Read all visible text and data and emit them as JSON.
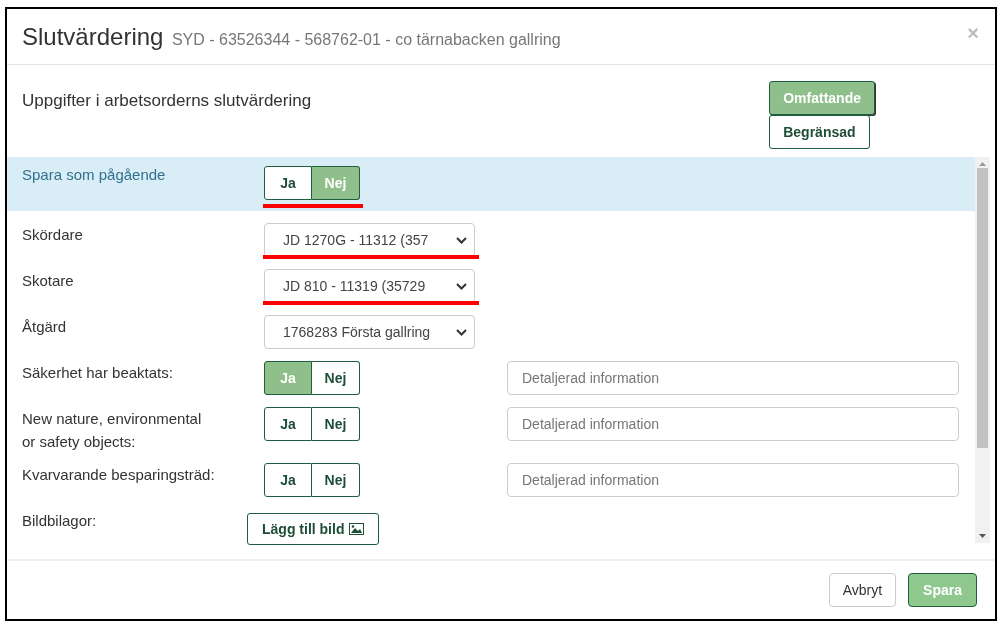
{
  "dialog": {
    "title": "Slutvärdering",
    "subtitle": "SYD - 63526344 - 568762-01 - co tärnabacken gallring",
    "close": "×"
  },
  "section": {
    "heading": "Uppgifter i arbetsorderns slutvärdering",
    "modes": [
      {
        "label": "Omfattande",
        "selected": true
      },
      {
        "label": "Begränsad",
        "selected": false
      }
    ]
  },
  "rows": [
    {
      "kind": "toggle",
      "label": "Spara som pågående",
      "highlighted": true,
      "annotated": true,
      "options": [
        {
          "label": "Ja",
          "selected": false
        },
        {
          "label": "Nej",
          "selected": true
        }
      ]
    },
    {
      "kind": "select",
      "label": "Skördare",
      "annotated": true,
      "value": "JD 1270G - 11312 (357"
    },
    {
      "kind": "select",
      "label": "Skotare",
      "annotated": true,
      "value": "JD 810 - 11319 (35729"
    },
    {
      "kind": "select",
      "label": "Åtgärd",
      "value": "1768283 Första gallring"
    },
    {
      "kind": "toggle",
      "label": "Säkerhet har beaktats:",
      "options": [
        {
          "label": "Ja",
          "selected": true
        },
        {
          "label": "Nej",
          "selected": false
        }
      ],
      "placeholder": "Detaljerad information"
    },
    {
      "kind": "toggle",
      "label": "New nature, environmental or safety objects:",
      "options": [
        {
          "label": "Ja",
          "selected": false
        },
        {
          "label": "Nej",
          "selected": false
        }
      ],
      "placeholder": "Detaljerad information"
    },
    {
      "kind": "toggle",
      "label": "Kvarvarande besparingsträd:",
      "options": [
        {
          "label": "Ja",
          "selected": false
        },
        {
          "label": "Nej",
          "selected": false
        }
      ],
      "placeholder": "Detaljerad information"
    },
    {
      "kind": "button",
      "label": "Bildbilagor:",
      "button": "Lägg till bild"
    }
  ],
  "footer": {
    "buttons": [
      {
        "label": "Avbryt",
        "kind": "secondary"
      },
      {
        "label": "Spara",
        "kind": "primary"
      }
    ]
  }
}
